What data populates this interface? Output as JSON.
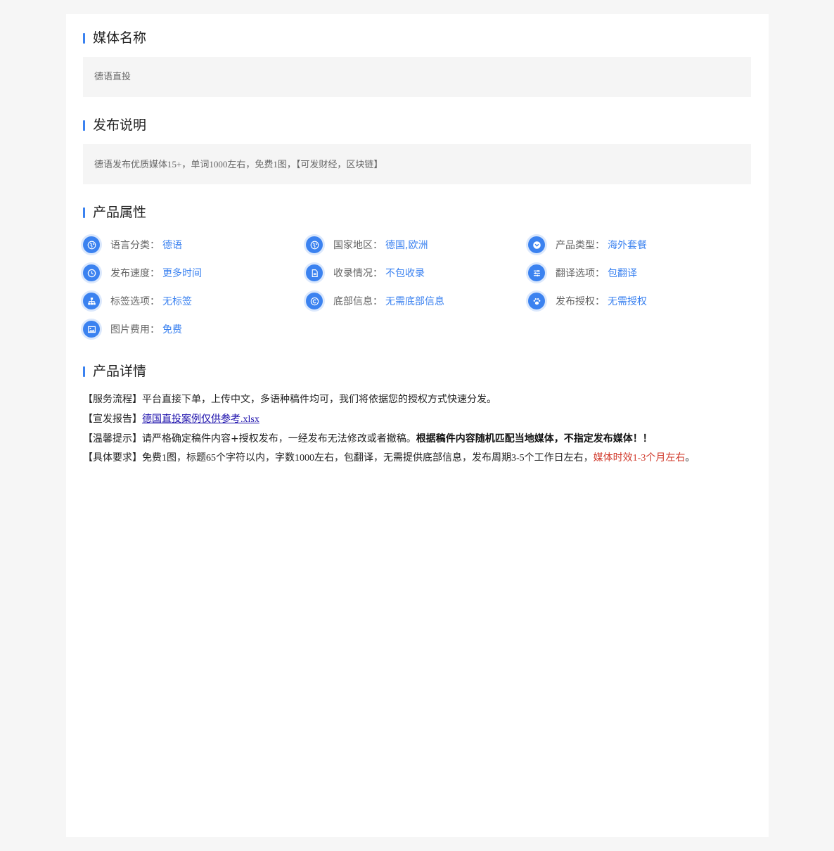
{
  "sections": {
    "media_name": {
      "title": "媒体名称",
      "value": "德语直投"
    },
    "publish_notes": {
      "title": "发布说明",
      "value": "德语发布优质媒体15+，单词1000左右，免费1图，【可发财经，区块链】"
    },
    "attributes": {
      "title": "产品属性",
      "items": [
        {
          "icon": "globe-icon",
          "label": "语言分类：",
          "value": "德语"
        },
        {
          "icon": "globe-icon",
          "label": "国家地区：",
          "value": "德国,欧洲"
        },
        {
          "icon": "chevron-down-circle-icon",
          "label": "产品类型：",
          "value": "海外套餐"
        },
        {
          "icon": "clock-icon",
          "label": "发布速度：",
          "value": "更多时间"
        },
        {
          "icon": "document-icon",
          "label": "收录情况：",
          "value": "不包收录"
        },
        {
          "icon": "sliders-icon",
          "label": "翻译选项：",
          "value": "包翻译"
        },
        {
          "icon": "sitemap-icon",
          "label": "标签选项：",
          "value": "无标签"
        },
        {
          "icon": "copyright-icon",
          "label": "底部信息：",
          "value": "无需底部信息"
        },
        {
          "icon": "paw-icon",
          "label": "发布授权：",
          "value": "无需授权"
        },
        {
          "icon": "image-icon",
          "label": "图片费用：",
          "value": "免费"
        }
      ]
    },
    "details": {
      "title": "产品详情",
      "service_flow": {
        "label": "【服务流程】",
        "text": "平台直接下单，上传中文，多语种稿件均可，我们将依据您的授权方式快速分发。"
      },
      "report": {
        "label": "【宣发报告】",
        "link": "德国直投案例仅供参考.xlsx"
      },
      "tips": {
        "label": "【温馨提示】",
        "text": "请严格确定稿件内容+授权发布，一经发布无法修改或者撤稿。",
        "bold": "根据稿件内容随机匹配当地媒体，不指定发布媒体！！"
      },
      "requirements": {
        "label": "【具体要求】",
        "text": "免费1图，标题65个字符以内，字数1000左右，包翻译，无需提供底部信息，发布周期3-5个工作日左右，",
        "highlight": "媒体时效1-3个月左右",
        "end": "。"
      }
    }
  },
  "colors": {
    "accent": "#3b82f0",
    "highlight": "#d0382a",
    "link": "#1a0dab"
  }
}
